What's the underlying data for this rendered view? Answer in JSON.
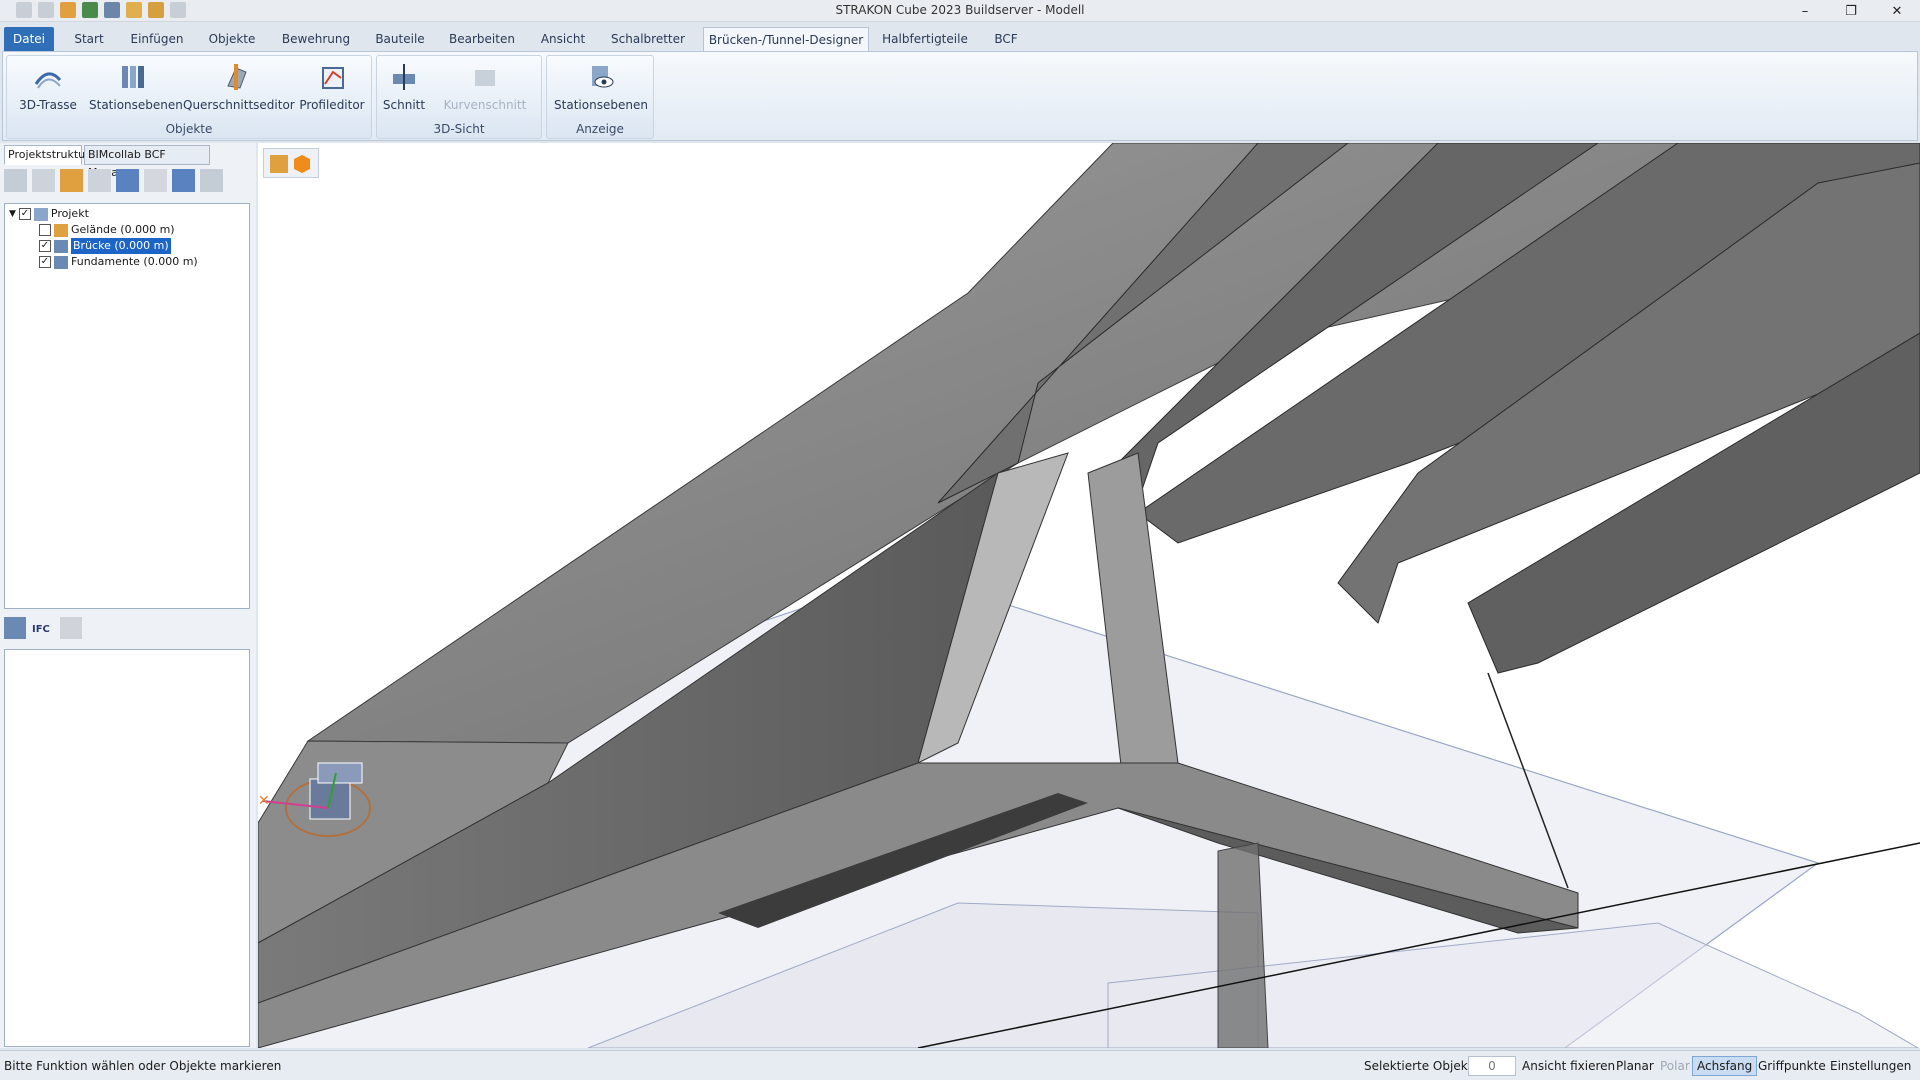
{
  "window": {
    "title": "STRAKON Cube 2023 Buildserver - Modell"
  },
  "tabs": [
    "Datei",
    "Start",
    "Einfügen",
    "Objekte",
    "Bewehrung",
    "Bauteile",
    "Bearbeiten",
    "Ansicht",
    "Schalbretter",
    "Brücken-/Tunnel-Designer",
    "Halbfertigteile",
    "BCF"
  ],
  "ribbon": {
    "groups": [
      {
        "label": "Objekte",
        "buttons": [
          "3D-Trasse",
          "Stationsebenen",
          "Querschnittseditor",
          "Profileditor"
        ]
      },
      {
        "label": "3D-Sicht",
        "buttons": [
          "Schnitt",
          "Kurvenschnitt"
        ]
      },
      {
        "label": "Anzeige",
        "buttons": [
          "Stationsebenen"
        ]
      }
    ]
  },
  "panel": {
    "tabs": [
      "Projektstruktur",
      "BIMcollab BCF Manager"
    ],
    "tree": [
      {
        "label": "Projekt",
        "checked": true
      },
      {
        "label": "Gelände (0.000 m)",
        "checked": false
      },
      {
        "label": "Brücke (0.000 m)",
        "checked": true,
        "selected": true
      },
      {
        "label": "Fundamente (0.000 m)",
        "checked": true
      }
    ],
    "ifc_label": "IFC"
  },
  "status": {
    "message": "Bitte Funktion wählen oder Objekte markieren",
    "selected_label": "Selektierte Objekte",
    "selected_count": "0",
    "items": [
      "Ansicht fixieren",
      "Planar",
      "Polar",
      "Achsfang",
      "Griffpunkte",
      "Einstellungen"
    ]
  },
  "colors": {
    "accent": "#2f6fb8",
    "selection": "#1c64c6",
    "concrete": "#8a8a8a"
  }
}
